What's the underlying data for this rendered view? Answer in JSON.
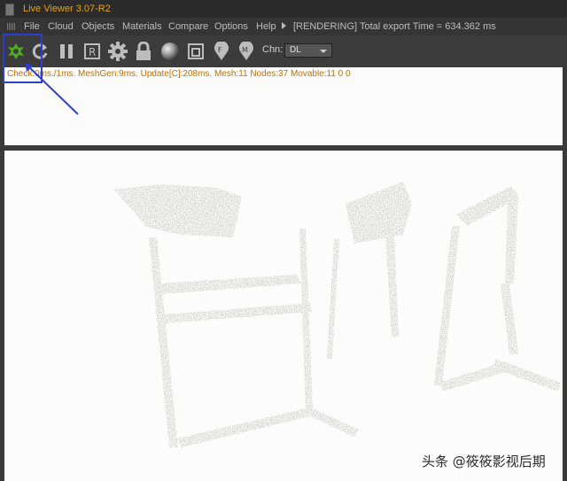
{
  "window": {
    "title": "Live Viewer 3.07-R2"
  },
  "menu": {
    "items": [
      "File",
      "Cloud",
      "Objects",
      "Materials",
      "Compare",
      "Options",
      "Help"
    ],
    "status": "[RENDERING] Total export Time = 634.362 ms"
  },
  "toolbar": {
    "icons": [
      "render-start-icon",
      "refresh-icon",
      "pause-icon",
      "region-render-icon",
      "settings-gear-icon",
      "lock-icon",
      "material-sphere-icon",
      "window-icon",
      "focus-pin-icon",
      "material-pin-icon"
    ],
    "channel_label": "Chn:",
    "channel_value": "DL"
  },
  "status": {
    "text": "Check:0ms./1ms. MeshGen:9ms. Update[C]:208ms. Mesh:11 Nodes:37 Movable:11  0 0"
  },
  "watermark": {
    "text": "头条 @筱筱影视后期"
  },
  "colors": {
    "title_text": "#f0a000",
    "status_text": "#c07000",
    "highlight": "#2a3fcf",
    "start_icon": "#4caf20"
  }
}
